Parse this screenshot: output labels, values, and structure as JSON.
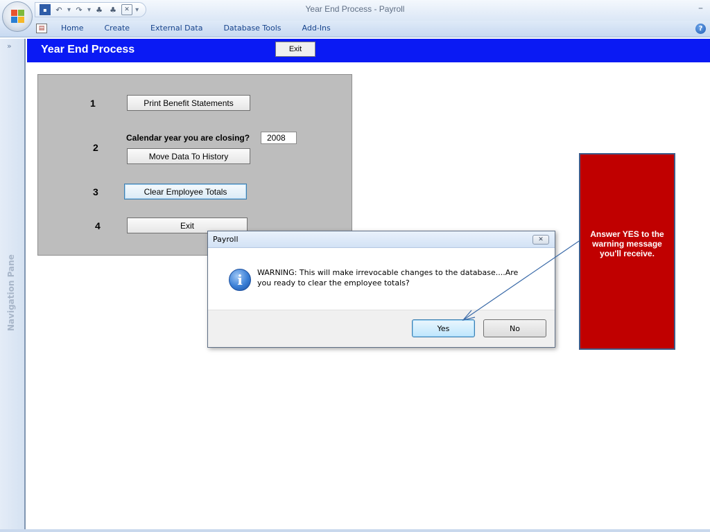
{
  "window": {
    "title": "Year End Process - Payroll",
    "minimize_glyph": "–"
  },
  "ribbon": {
    "tabs": [
      "Home",
      "Create",
      "External Data",
      "Database Tools",
      "Add-Ins"
    ]
  },
  "nav_pane": {
    "label": "Navigation Pane",
    "chevron": "»"
  },
  "form": {
    "title": "Year End Process",
    "header_exit_label": "Exit",
    "steps": [
      {
        "number": "1",
        "button_label": "Print Benefit Statements"
      },
      {
        "number": "2",
        "year_prompt": "Calendar year you are closing?",
        "year_value": "2008",
        "button_label": "Move Data To History"
      },
      {
        "number": "3",
        "button_label": "Clear Employee Totals"
      },
      {
        "number": "4",
        "button_label": "Exit"
      }
    ]
  },
  "dialog": {
    "title": "Payroll",
    "close_glyph": "✕",
    "message": "WARNING: This will make irrevocable changes to the database....Are you ready to clear the employee totals?",
    "yes_label": "Yes",
    "no_label": "No",
    "icon": "information-icon"
  },
  "callout": {
    "text": "Answer YES to the warning message  you'll receive.",
    "color": "#c00000"
  },
  "colors": {
    "form_header": "#0a1af4",
    "panel": "#bdbdbd",
    "callout": "#c00000"
  }
}
